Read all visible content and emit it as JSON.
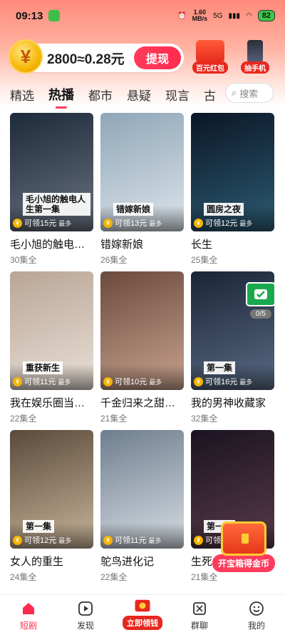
{
  "status_bar": {
    "time": "09:13",
    "net_speed": "1.60",
    "net_unit": "MB/s",
    "signal": "5G",
    "battery": "82"
  },
  "header": {
    "coin_amount": "2800≈0.28元",
    "withdraw_label": "提现",
    "promo_red_packet": "百元红包",
    "promo_phone": "抽手机"
  },
  "tabs": [
    {
      "label": "精选"
    },
    {
      "label": "热播"
    },
    {
      "label": "都市"
    },
    {
      "label": "悬疑"
    },
    {
      "label": "现言"
    },
    {
      "label": "古"
    }
  ],
  "search": {
    "placeholder": "搜索"
  },
  "dramas": [
    {
      "title": "毛小旭的触电…",
      "episodes": "30集全",
      "reward": "可领15元",
      "max": "最多",
      "caption": "毛小旭的触电人生第一集",
      "color1": "#1d2a3a",
      "color2": "#6a7380"
    },
    {
      "title": "错嫁新娘",
      "episodes": "26集全",
      "reward": "可领13元",
      "max": "最多",
      "caption": "错嫁新娘",
      "color1": "#8fa6b8",
      "color2": "#dde5ea"
    },
    {
      "title": "长生",
      "episodes": "25集全",
      "reward": "可领12元",
      "max": "最多",
      "caption": "圆房之夜",
      "color1": "#0b1626",
      "color2": "#2d5b73"
    },
    {
      "title": "我在娱乐圈当…",
      "episodes": "22集全",
      "reward": "可领11元",
      "max": "最多",
      "caption": "重获新生",
      "color1": "#b9a595",
      "color2": "#e9e0d8"
    },
    {
      "title": "千金归来之甜…",
      "episodes": "21集全",
      "reward": "可领10元",
      "max": "最多",
      "caption": "",
      "color1": "#6b4a3d",
      "color2": "#c9a38f"
    },
    {
      "title": "我的男神收藏家",
      "episodes": "32集全",
      "reward": "可领16元",
      "max": "最多",
      "caption": "第一集",
      "color1": "#1a2436",
      "color2": "#5a6b84"
    },
    {
      "title": "女人的重生",
      "episodes": "24集全",
      "reward": "可领12元",
      "max": "最多",
      "caption": "第一集",
      "color1": "#5a4a3a",
      "color2": "#c8b49a"
    },
    {
      "title": "鸵鸟进化记",
      "episodes": "22集全",
      "reward": "可领11元",
      "max": "最多",
      "caption": "",
      "color1": "#6e7e8e",
      "color2": "#d8dee4"
    },
    {
      "title": "生死…",
      "episodes": "21集全",
      "reward": "可领10元",
      "max": "最多",
      "caption": "第一集",
      "color1": "#1a1420",
      "color2": "#5a3a4a"
    }
  ],
  "float_task": {
    "progress": "0/5"
  },
  "treasure": {
    "label": "开宝箱得金币"
  },
  "nav": [
    {
      "label": "短剧"
    },
    {
      "label": "发现"
    },
    {
      "label": "立即领钱"
    },
    {
      "label": "群聊"
    },
    {
      "label": "我的"
    }
  ]
}
